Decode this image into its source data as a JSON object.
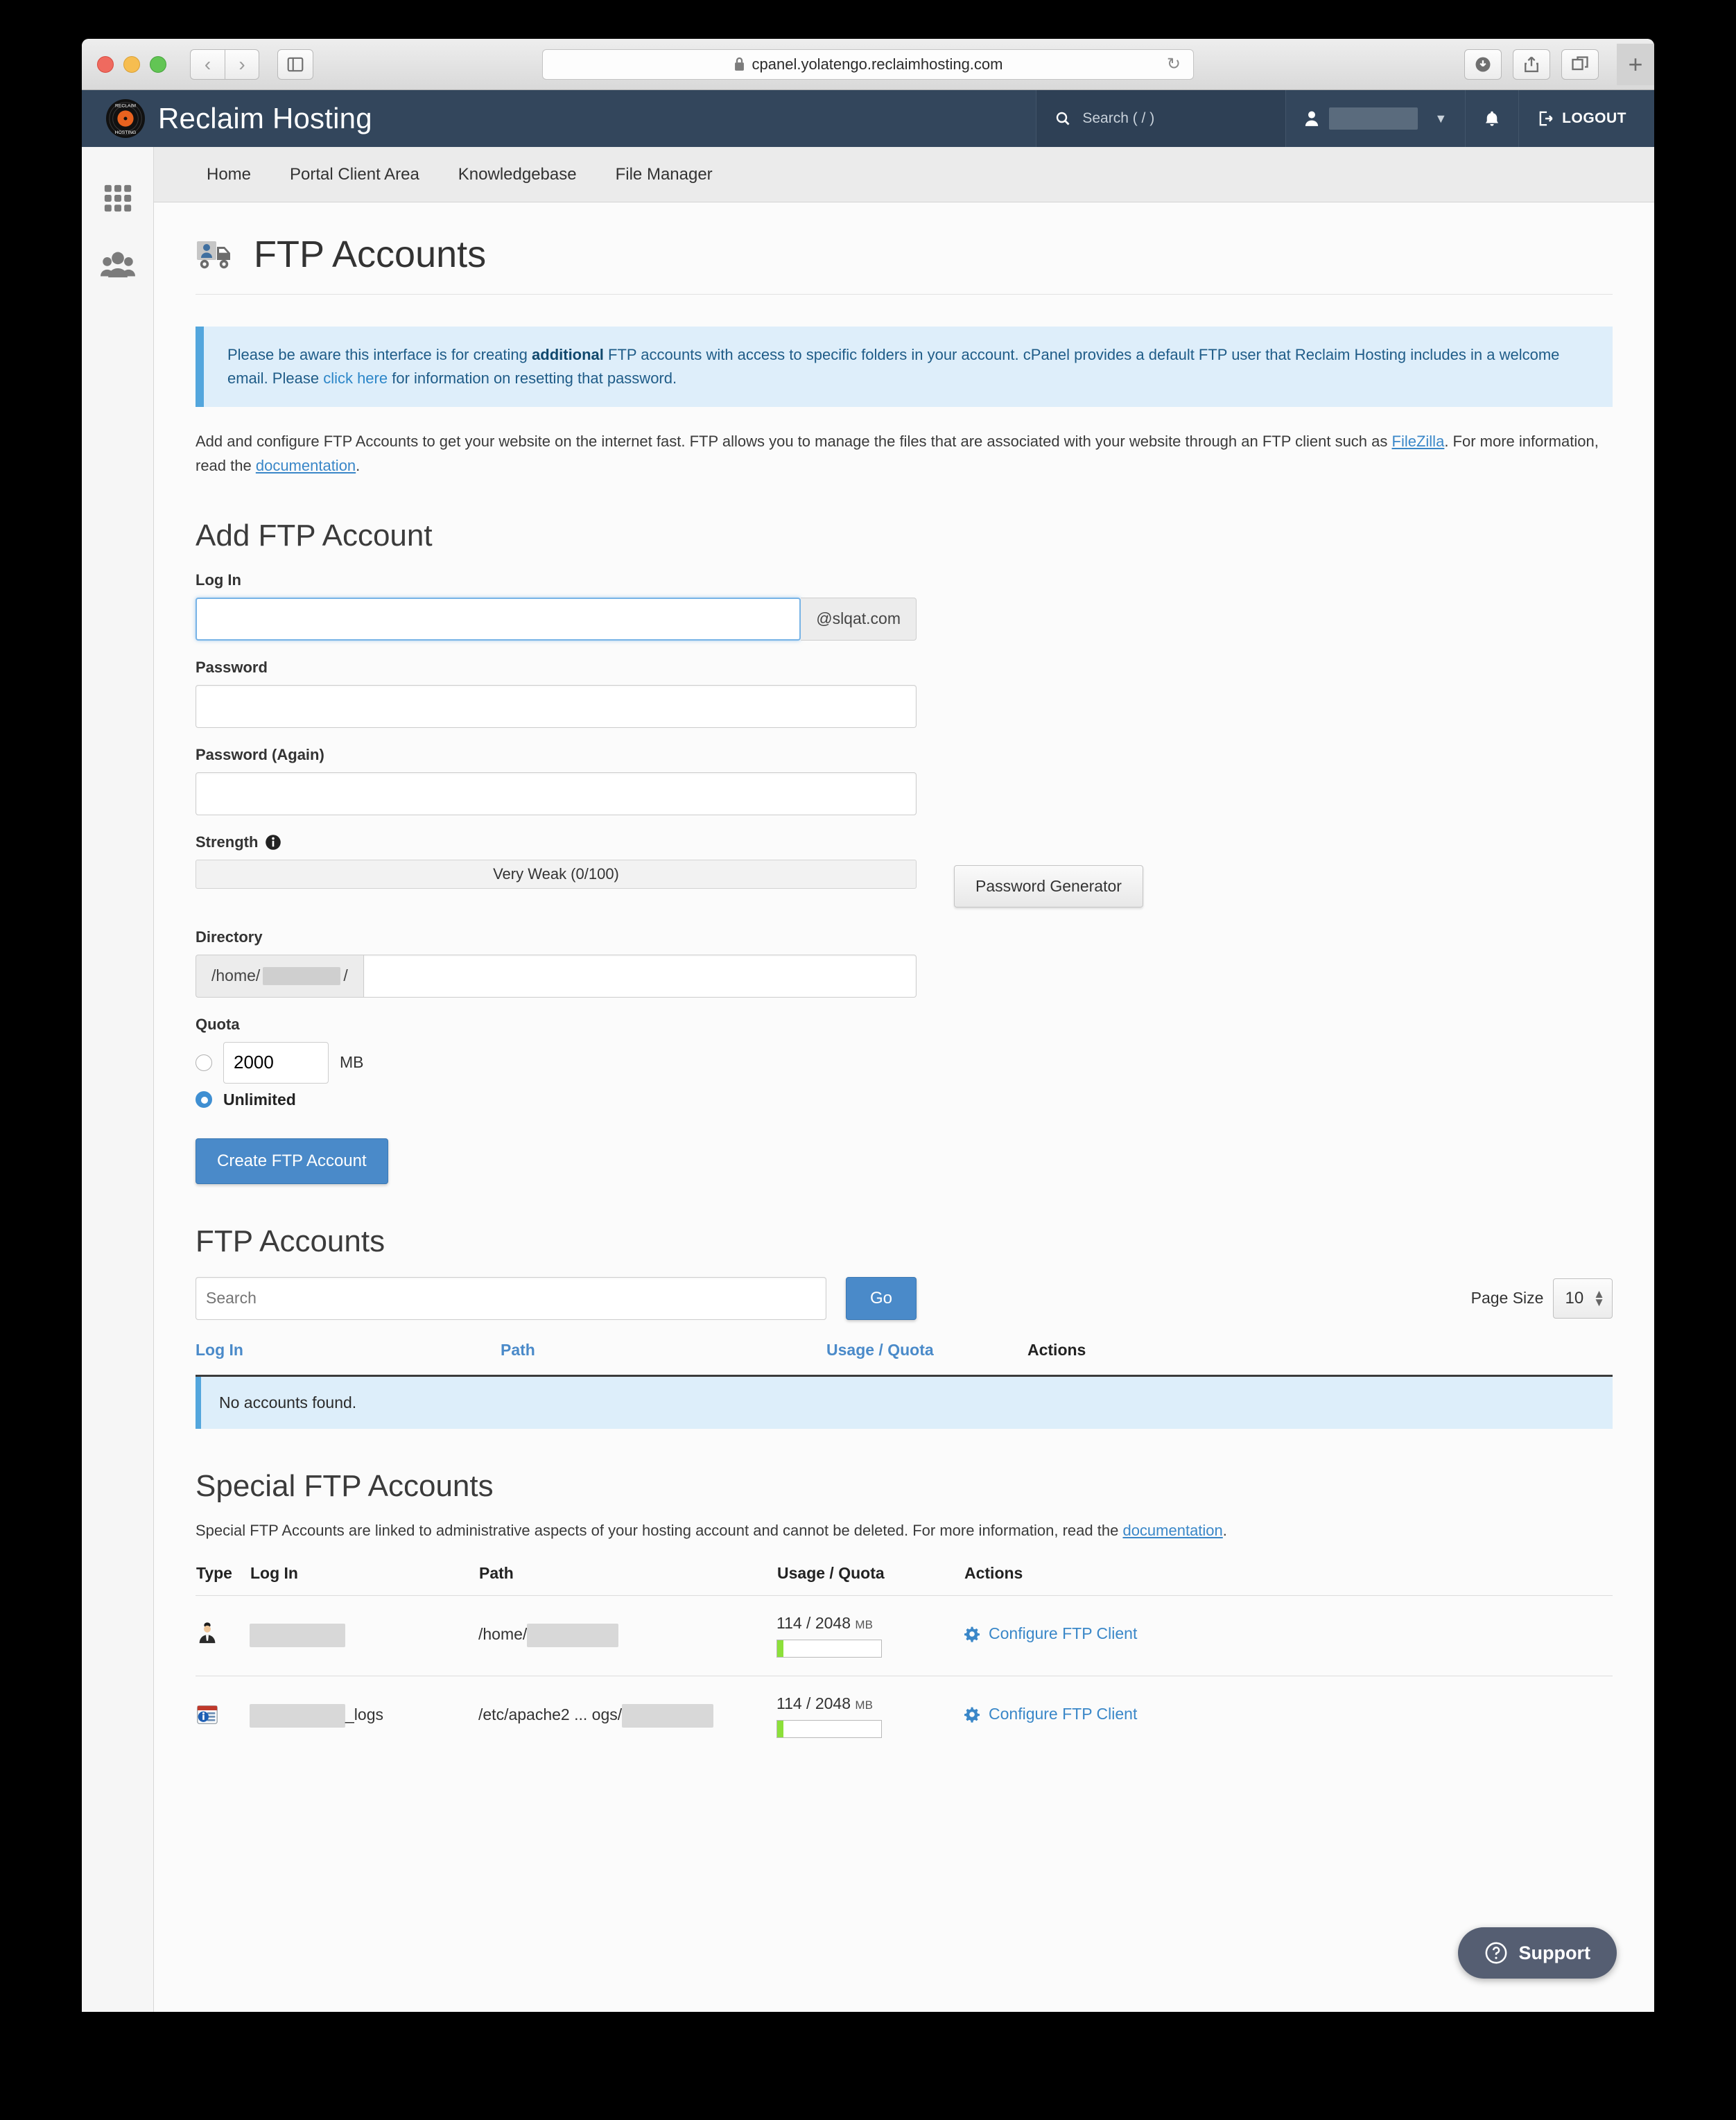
{
  "browser": {
    "url": "cpanel.yolatengo.reclaimhosting.com",
    "back_icon": "‹",
    "forward_icon": "›",
    "sidebar_icon": "sidebar-icon",
    "reload_icon": "↻",
    "download_icon": "download-icon",
    "share_icon": "share-icon",
    "tabs_icon": "tabs-icon",
    "newtab_label": "+"
  },
  "header": {
    "brand": "Reclaim Hosting",
    "search_placeholder": "Search ( / )",
    "user_name": "",
    "logout_label": "LOGOUT"
  },
  "nav": {
    "items": [
      {
        "label": "Home"
      },
      {
        "label": "Portal Client Area"
      },
      {
        "label": "Knowledgebase"
      },
      {
        "label": "File Manager"
      }
    ]
  },
  "rail": {
    "items": [
      {
        "name": "apps-grid-icon"
      },
      {
        "name": "users-icon"
      }
    ]
  },
  "page": {
    "title": "FTP Accounts",
    "notice": {
      "part1": "Please be aware this interface is for creating ",
      "bold": "additional",
      "part2": " FTP accounts with access to specific folders in your account. cPanel provides a default FTP user that Reclaim Hosting includes in a welcome email. Please ",
      "link": "click here",
      "part3": " for information on resetting that password."
    },
    "lead": {
      "part1": "Add and configure FTP Accounts to get your website on the internet fast. FTP allows you to manage the files that are associated with your website through an FTP client such as ",
      "link1": "FileZilla",
      "part2": ". For more information, read the ",
      "link2": "documentation",
      "part3": "."
    }
  },
  "add_form": {
    "heading": "Add FTP Account",
    "login_label": "Log In",
    "login_value": "",
    "login_suffix": "@slqat.com",
    "password_label": "Password",
    "password_value": "",
    "password_again_label": "Password (Again)",
    "password_again_value": "",
    "strength_label": "Strength",
    "strength_info_icon": "info-icon",
    "strength_text": "Very Weak (0/100)",
    "strength_value": 0,
    "strength_max": 100,
    "password_generator_label": "Password Generator",
    "directory_label": "Directory",
    "directory_prefix": "/home/",
    "directory_prefix_suffix": "/",
    "directory_value": "",
    "quota_label": "Quota",
    "quota_number": "2000",
    "quota_unit": "MB",
    "quota_number_selected": false,
    "unlimited_label": "Unlimited",
    "unlimited_selected": true,
    "submit_label": "Create FTP Account"
  },
  "accounts": {
    "heading": "FTP Accounts",
    "search_placeholder": "Search",
    "search_value": "",
    "go_label": "Go",
    "page_size_label": "Page Size",
    "page_size_value": "10",
    "columns": [
      "Log In",
      "Path",
      "Usage / Quota",
      "Actions"
    ],
    "empty_message": "No accounts found."
  },
  "special": {
    "heading": "Special FTP Accounts",
    "description": {
      "part1": "Special FTP Accounts are linked to administrative aspects of your hosting account and cannot be deleted. For more information, read the ",
      "link": "documentation",
      "part2": "."
    },
    "columns": [
      "Type",
      "Log In",
      "Path",
      "Usage / Quota",
      "Actions"
    ],
    "rows": [
      {
        "type_icon": "user-account-icon",
        "login": "",
        "login_suffix": "",
        "path_prefix": "/home/",
        "path_redacted": true,
        "usage": "114 / 2048",
        "usage_unit": "MB",
        "usage_percent": 5.6,
        "action_label": "Configure FTP Client",
        "action_icon": "gear-icon"
      },
      {
        "type_icon": "logs-calendar-icon",
        "login": "",
        "login_suffix": "_logs",
        "path_prefix": "/etc/apache2 ... ogs/",
        "path_redacted": true,
        "usage": "114 / 2048",
        "usage_unit": "MB",
        "usage_percent": 5.6,
        "action_label": "Configure FTP Client",
        "action_icon": "gear-icon"
      }
    ]
  },
  "support": {
    "label": "Support",
    "icon": "question-circle-icon"
  }
}
